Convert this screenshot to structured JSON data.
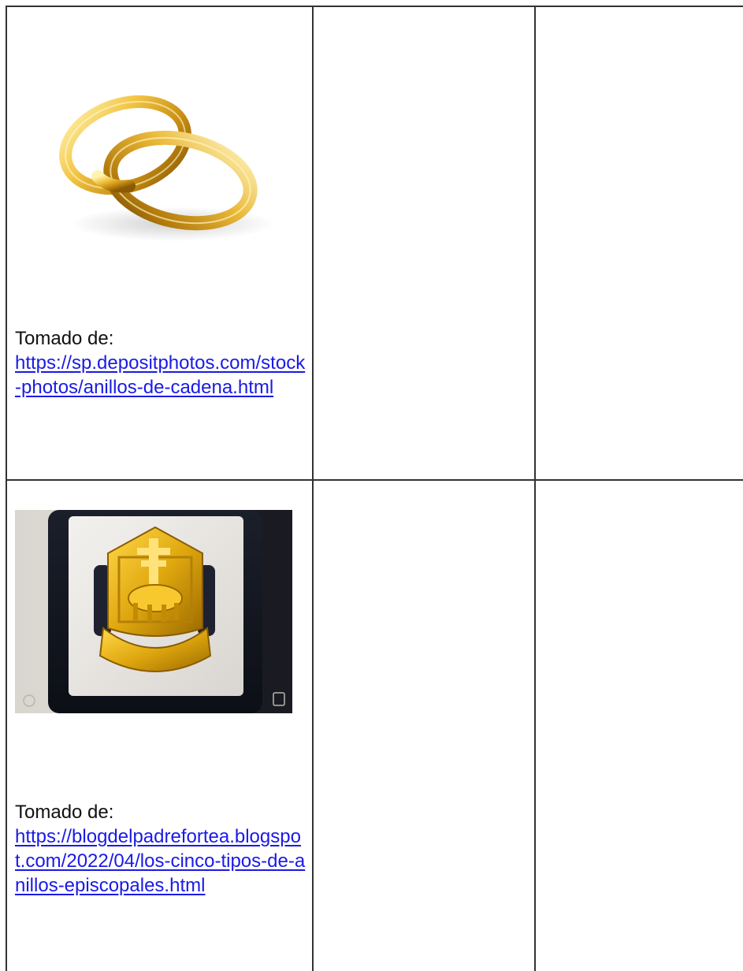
{
  "rows": [
    {
      "caption_lead": "Tomado de:",
      "link_text": "https://sp.depositphotos.com/stock-photos/anillos-de-cadena.html",
      "image": "gold-wedding-rings"
    },
    {
      "caption_lead": "Tomado de:",
      "link_text": "https://blogdelpadrefortea.blogspot.com/2022/04/los-cinco-tipos-de-anillos-episcopales.html",
      "image": "episcopal-gold-ring-in-box"
    }
  ],
  "colors": {
    "link": "#1a1ae6",
    "border": "#333333",
    "gold": "#d9a520"
  }
}
